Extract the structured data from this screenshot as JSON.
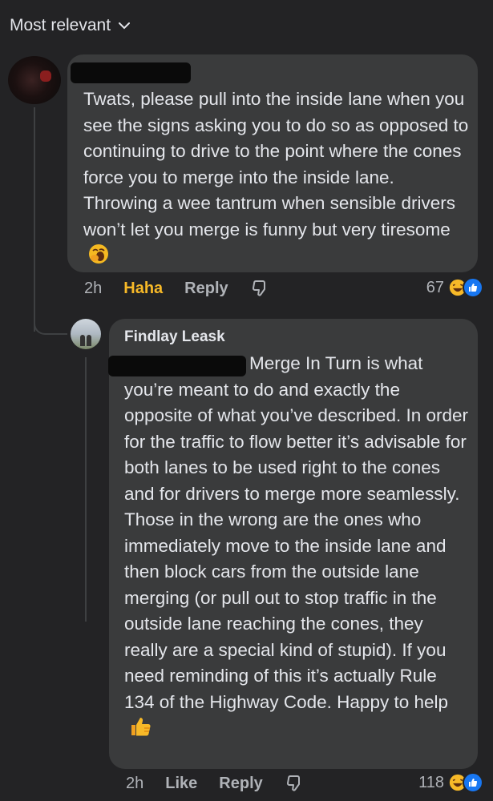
{
  "sort": {
    "label": "Most relevant"
  },
  "comment1": {
    "text": "Twats, please pull into the inside lane when you see the signs asking you to do so as opposed to continuing to drive to the point where the cones force you to merge into the inside lane. Throwing a wee tantrum when sensible drivers  won’t let you merge is funny but very  tiresome",
    "time": "2h",
    "reaction_label": "Haha",
    "reply_label": "Reply",
    "reaction_count": "67",
    "reaction_icons": [
      "haha-emoji",
      "like-emoji"
    ]
  },
  "comment2": {
    "author": "Findlay Leask",
    "text": "Merge In Turn is what you’re meant to do and exactly the opposite of what you’ve described. In order for the traffic to flow better it’s advisable for both lanes to be used right to the cones and for drivers to merge more seamlessly. Those in the wrong are the ones who immediately move to the inside lane and then block cars from the outside lane merging (or pull out to stop traffic in the outside lane reaching the cones, they really are a special kind of stupid). If you need reminding of this it’s actually Rule 134 of the Highway Code. Happy to help",
    "time": "2h",
    "like_label": "Like",
    "reply_label": "Reply",
    "reaction_count": "118",
    "reaction_icons": [
      "haha-emoji",
      "like-emoji"
    ]
  },
  "colors": {
    "background": "#232325",
    "bubble": "#3a3b3c",
    "haha": "#f7b928",
    "like": "#1877f2"
  }
}
